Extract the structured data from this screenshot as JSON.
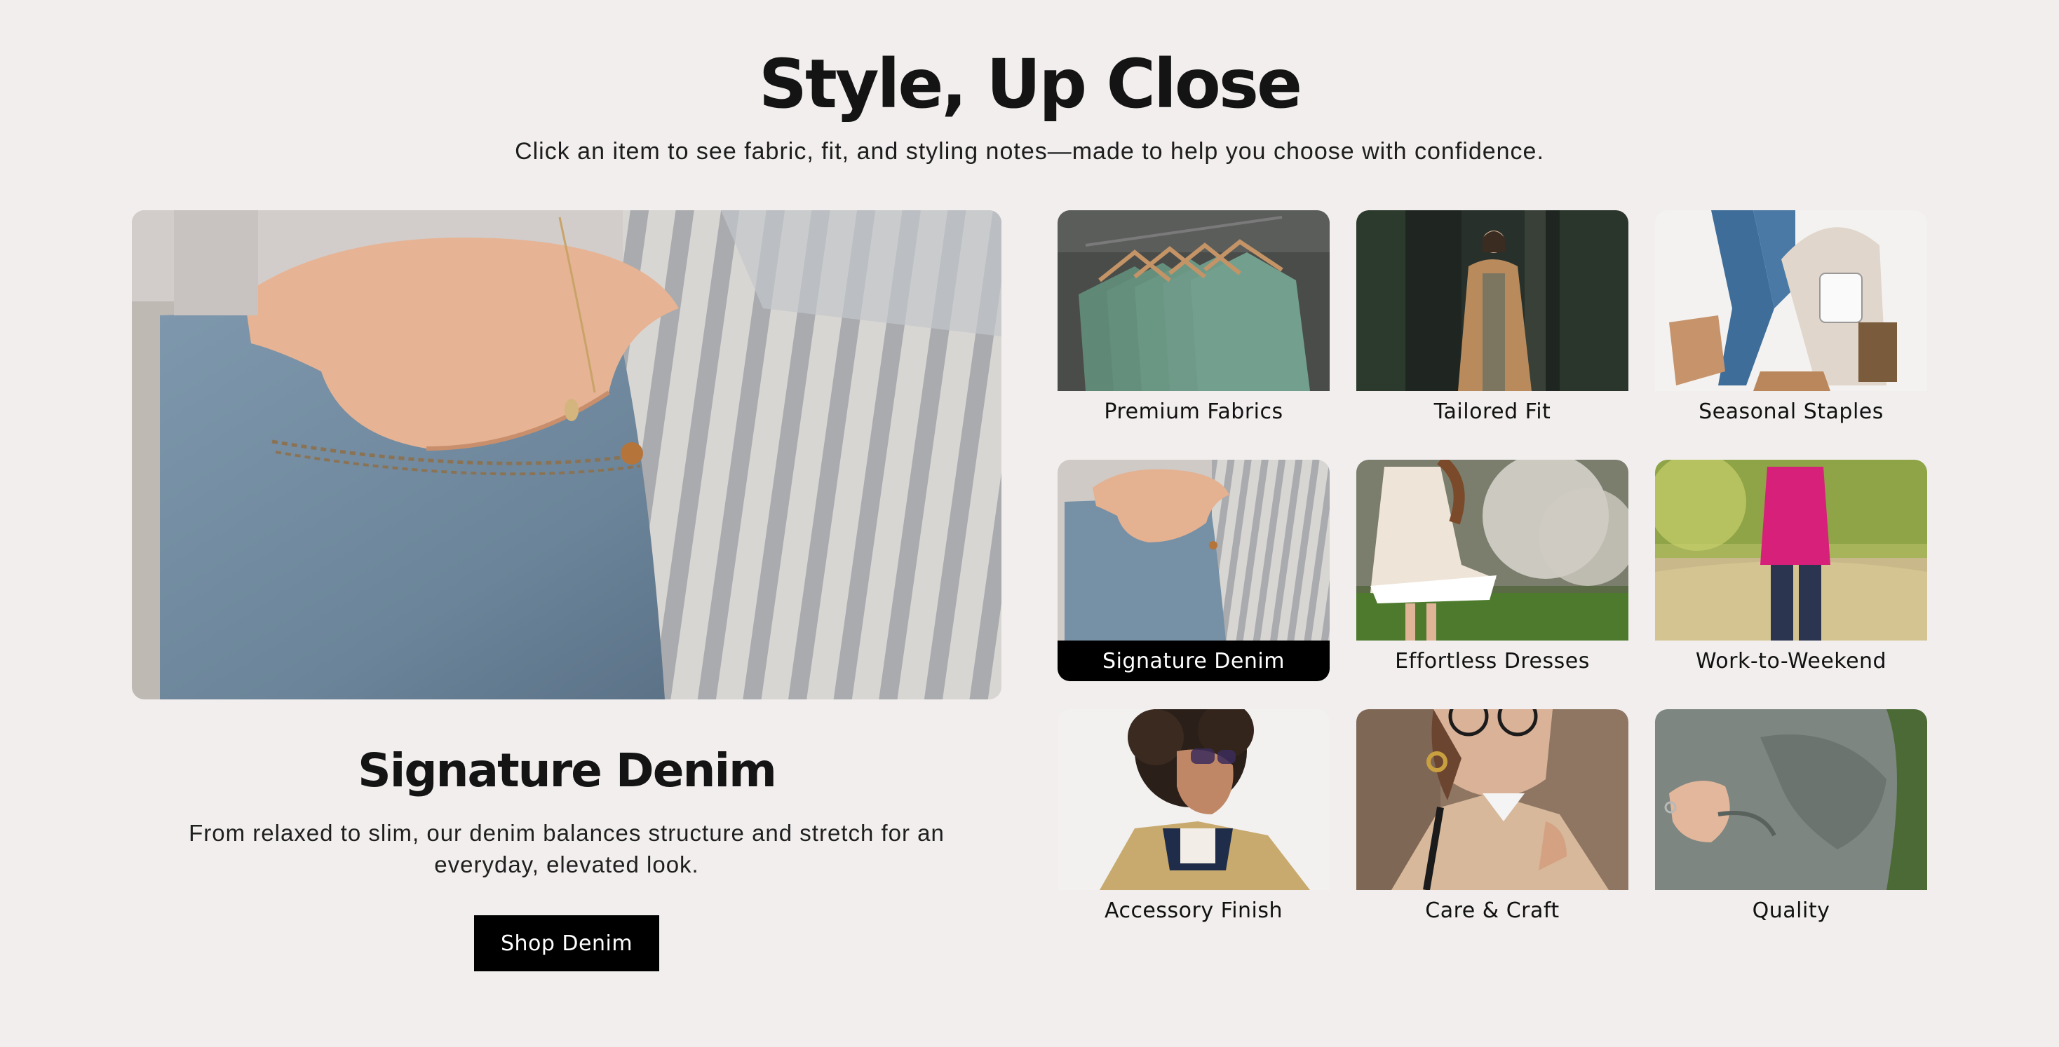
{
  "header": {
    "title": "Style, Up Close",
    "subtitle": "Click an item to see fabric, fit, and styling notes—made to help you choose with confidence."
  },
  "featured": {
    "title": "Signature Denim",
    "description": "From relaxed to slim, our denim balances structure and stretch for an everyday, elevated look.",
    "cta_label": "Shop Denim"
  },
  "grid": {
    "items": [
      {
        "label": "Premium Fabrics"
      },
      {
        "label": "Tailored Fit"
      },
      {
        "label": "Seasonal Staples"
      },
      {
        "label": "Signature Denim",
        "active": true
      },
      {
        "label": "Effortless Dresses"
      },
      {
        "label": "Work-to-Weekend"
      },
      {
        "label": "Accessory Finish"
      },
      {
        "label": "Care & Craft"
      },
      {
        "label": "Quality"
      }
    ]
  },
  "colors": {
    "background": "#f1eeed",
    "text": "#141414",
    "button": "#000000",
    "active_label_bg": "#000000"
  }
}
